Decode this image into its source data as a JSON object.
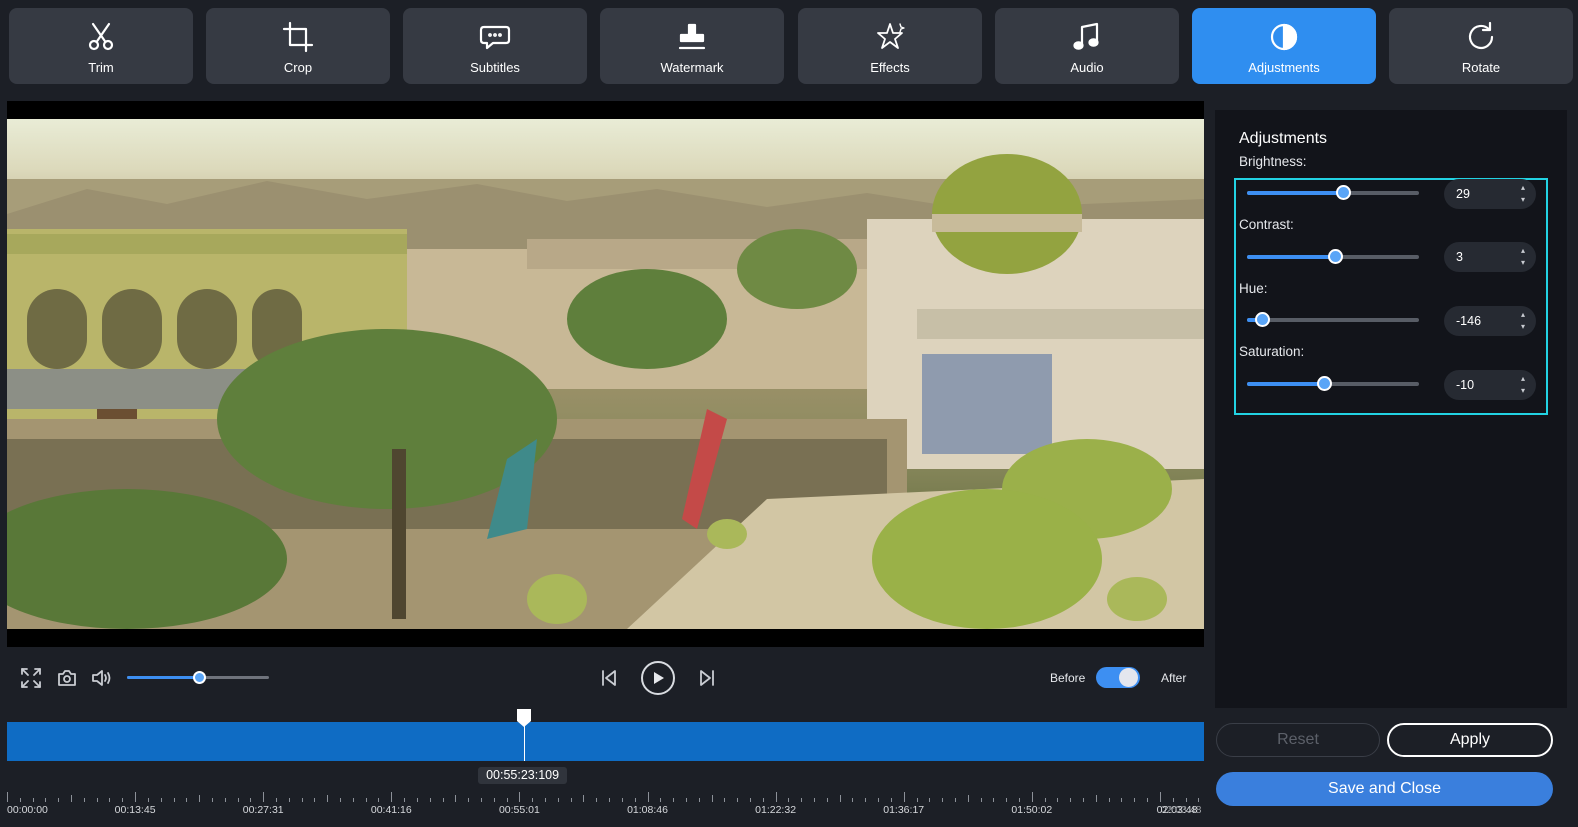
{
  "toolbar": {
    "items": [
      {
        "label": "Trim",
        "icon": "scissors-icon"
      },
      {
        "label": "Crop",
        "icon": "crop-icon"
      },
      {
        "label": "Subtitles",
        "icon": "speech-bubble-icon"
      },
      {
        "label": "Watermark",
        "icon": "stamp-icon"
      },
      {
        "label": "Effects",
        "icon": "sparkle-star-icon"
      },
      {
        "label": "Audio",
        "icon": "music-note-icon"
      },
      {
        "label": "Adjustments",
        "icon": "contrast-half-circle-icon"
      },
      {
        "label": "Rotate",
        "icon": "rotate-clockwise-icon"
      }
    ],
    "active": "Adjustments"
  },
  "player": {
    "volume_fraction": 0.51,
    "before_label": "Before",
    "after_label": "After",
    "compare_toggle_on": true
  },
  "timeline": {
    "current_time": "00:55:23:109",
    "playhead_fraction": 0.432,
    "ruler_labels": [
      "00:00:00",
      "00:13:45",
      "00:27:31",
      "00:41:16",
      "00:55:01",
      "01:08:46",
      "01:22:32",
      "01:36:17",
      "01:50:02",
      "02:03:48"
    ],
    "end_label_overlap": "02:03:48"
  },
  "panel": {
    "title": "Adjustments",
    "controls": [
      {
        "label": "Brightness:",
        "value": "29",
        "fraction": 0.56
      },
      {
        "label": "Contrast:",
        "value": "3",
        "fraction": 0.51
      },
      {
        "label": "Hue:",
        "value": "-146",
        "fraction": 0.09
      },
      {
        "label": "Saturation:",
        "value": "-10",
        "fraction": 0.45
      }
    ],
    "reset_label": "Reset",
    "apply_label": "Apply",
    "save_label": "Save and Close"
  },
  "colors": {
    "accent": "#2f8ef0",
    "highlight_border": "#22d3e3",
    "timeline": "#0f6cc4",
    "panel_bg": "#12141a",
    "app_bg": "#1c1f26"
  }
}
